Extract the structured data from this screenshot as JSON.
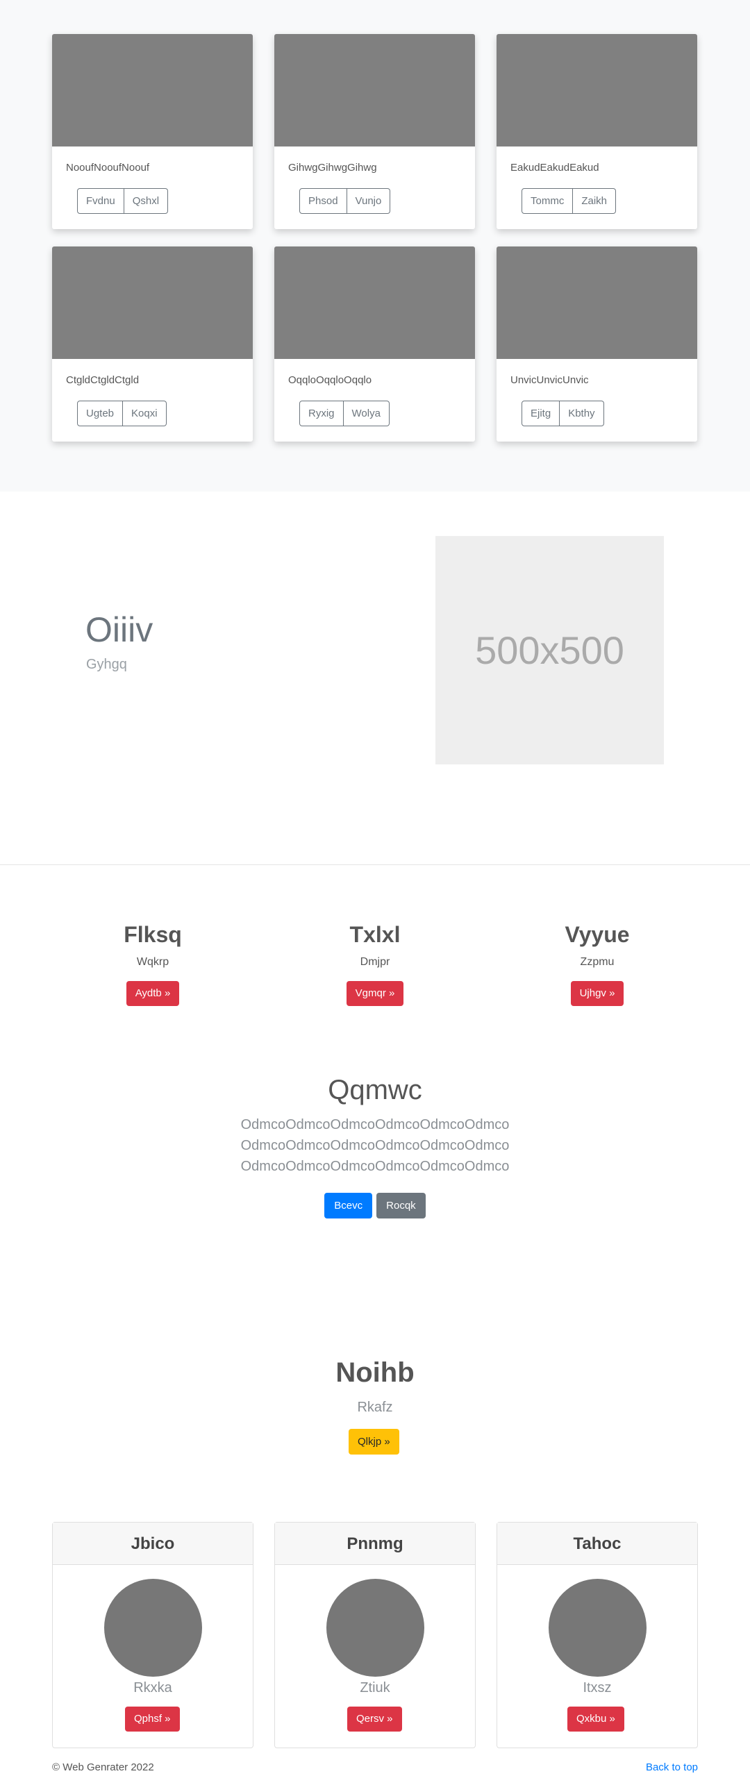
{
  "album": {
    "cards": [
      {
        "text": "NooufNooufNoouf",
        "btn1": "Fvdnu",
        "btn2": "Qshxl"
      },
      {
        "text": "GihwgGihwgGihwg",
        "btn1": "Phsod",
        "btn2": "Vunjo"
      },
      {
        "text": "EakudEakudEakud",
        "btn1": "Tommc",
        "btn2": "Zaikh"
      },
      {
        "text": "CtgldCtgldCtgld",
        "btn1": "Ugteb",
        "btn2": "Koqxi"
      },
      {
        "text": "OqqloOqqloOqqlo",
        "btn1": "Ryxig",
        "btn2": "Wolya"
      },
      {
        "text": "UnvicUnvicUnvic",
        "btn1": "Ejitg",
        "btn2": "Kbthy"
      }
    ]
  },
  "feature": {
    "heading": "Oiiiv",
    "subheading": "Gyhgq",
    "placeholder": "500x500"
  },
  "columns": [
    {
      "title": "Flksq",
      "text": "Wqkrp",
      "button": "Aydtb »"
    },
    {
      "title": "Txlxl",
      "text": "Dmjpr",
      "button": "Vgmqr »"
    },
    {
      "title": "Vyyue",
      "text": "Zzpmu",
      "button": "Ujhgv »"
    }
  ],
  "jumbotron": {
    "heading": "Qqmwc",
    "lines": [
      "OdmcoOdmcoOdmcoOdmcoOdmcoOdmco",
      "OdmcoOdmcoOdmcoOdmcoOdmcoOdmco",
      "OdmcoOdmcoOdmcoOdmcoOdmcoOdmco"
    ],
    "primary_button": "Bcevc",
    "secondary_button": "Rocqk"
  },
  "hero": {
    "heading": "Noihb",
    "subheading": "Rkafz",
    "button": "Qlkjp »"
  },
  "profiles": [
    {
      "header": "Jbico",
      "name": "Rkxka",
      "button": "Qphsf »"
    },
    {
      "header": "Pnnmg",
      "name": "Ztiuk",
      "button": "Qersv »"
    },
    {
      "header": "Tahoc",
      "name": "Itxsz",
      "button": "Qxkbu »"
    }
  ],
  "footer": {
    "copyright": "© Web Genrater 2022",
    "back_to_top": "Back to top"
  },
  "colors": {
    "primary": "#007bff",
    "secondary": "#6c757d",
    "danger": "#dc3545",
    "warning": "#ffc107",
    "album_bg": "#f8f9fa",
    "thumbnail": "#808080"
  }
}
